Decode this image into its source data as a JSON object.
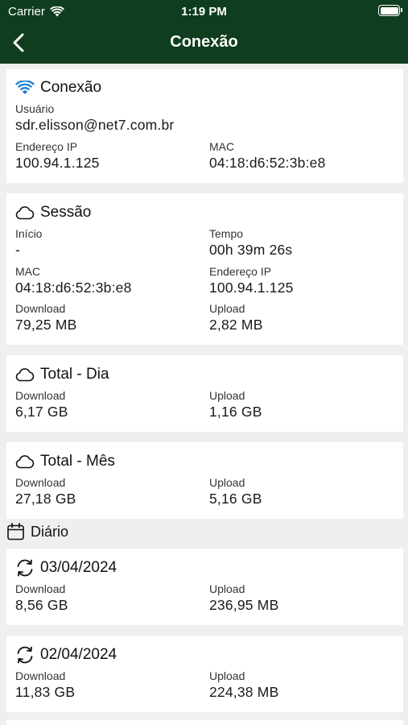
{
  "status_bar": {
    "carrier": "Carrier",
    "time": "1:19 PM",
    "wifi_icon": "wifi-icon",
    "battery_icon": "battery-icon"
  },
  "nav": {
    "title": "Conexão",
    "back_icon": "chevron-left-icon"
  },
  "colors": {
    "header_bg": "#0f3d1f",
    "page_bg": "#efefef",
    "wifi_accent": "#1e7fd6"
  },
  "connection": {
    "title": "Conexão",
    "user_label": "Usuário",
    "user_value": "sdr.elisson@net7.com.br",
    "ip_label": "Endereço IP",
    "ip_value": "100.94.1.125",
    "mac_label": "MAC",
    "mac_value": "04:18:d6:52:3b:e8"
  },
  "session": {
    "title": "Sessão",
    "start_label": "Início",
    "start_value": "-",
    "time_label": "Tempo",
    "time_value": "00h 39m 26s",
    "mac_label": "MAC",
    "mac_value": "04:18:d6:52:3b:e8",
    "ip_label": "Endereço IP",
    "ip_value": "100.94.1.125",
    "download_label": "Download",
    "download_value": "79,25 MB",
    "upload_label": "Upload",
    "upload_value": "2,82 MB"
  },
  "total_day": {
    "title": "Total - Dia",
    "download_label": "Download",
    "download_value": "6,17 GB",
    "upload_label": "Upload",
    "upload_value": "1,16 GB"
  },
  "total_month": {
    "title": "Total - Mês",
    "download_label": "Download",
    "download_value": "27,18 GB",
    "upload_label": "Upload",
    "upload_value": "5,16 GB"
  },
  "daily": {
    "title": "Diário",
    "items": [
      {
        "date": "03/04/2024",
        "download_label": "Download",
        "download_value": "8,56 GB",
        "upload_label": "Upload",
        "upload_value": "236,95 MB"
      },
      {
        "date": "02/04/2024",
        "download_label": "Download",
        "download_value": "11,83 GB",
        "upload_label": "Upload",
        "upload_value": "224,38 MB"
      }
    ]
  }
}
